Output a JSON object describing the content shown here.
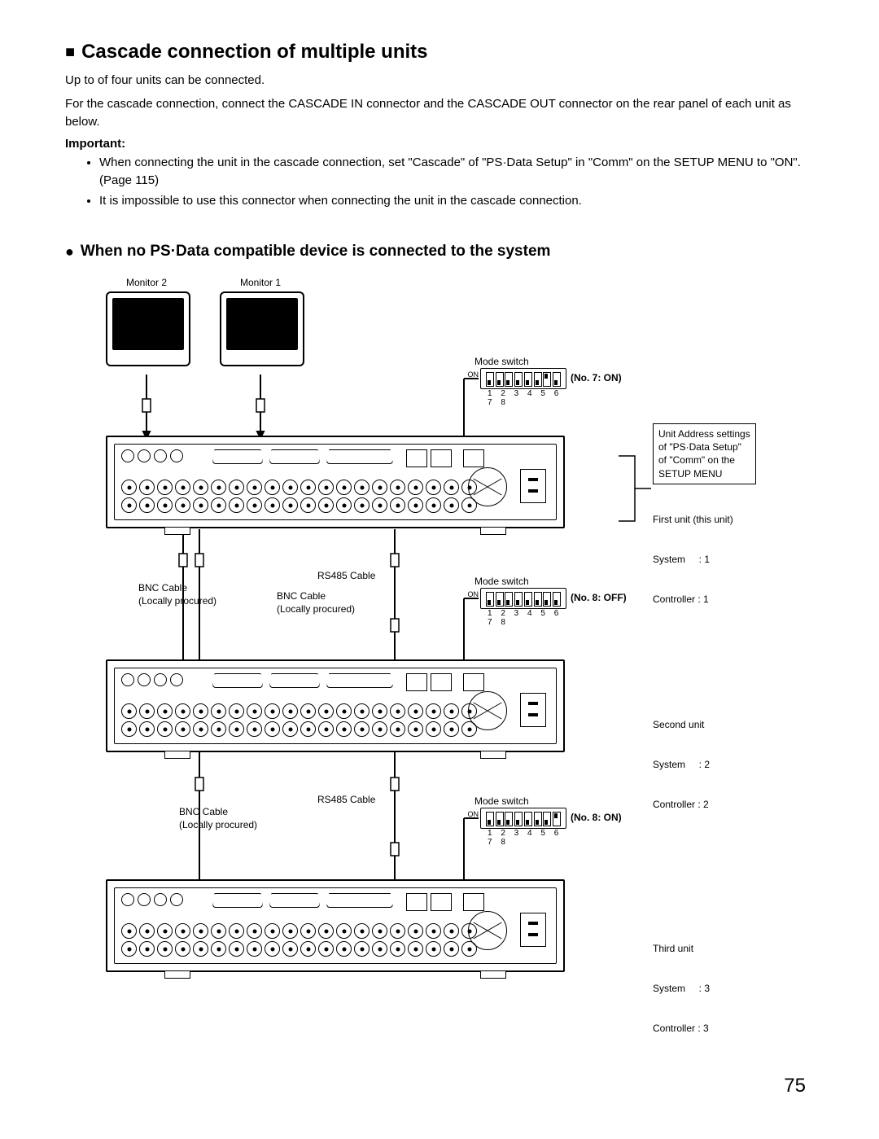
{
  "title_prefix": "■",
  "title": "Cascade connection of multiple units",
  "intro1": "Up to of four units can be connected.",
  "intro2": "For the cascade connection, connect the CASCADE IN connector and the CASCADE OUT connector on the rear panel of each unit as below.",
  "important_label": "Important:",
  "note1": "When connecting the unit in the cascade connection, set \"Cascade\" of \"PS·Data Setup\" in \"Comm\" on the SETUP MENU to \"ON\". (Page 115)",
  "note2": "It is impossible to use this connector when connecting the unit in the cascade connection.",
  "section_prefix": "●",
  "section_title": "When no PS·Data compatible device is connected to the system",
  "monitor2": "Monitor 2",
  "monitor1": "Monitor 1",
  "mode_switch_label": "Mode switch",
  "dip_numbers": "1 2 3 4 5 6 7 8",
  "dip_on": "ON",
  "dip1_note": "(No. 7: ON)",
  "dip2_note": "(No. 8: OFF)",
  "dip3_note": "(No. 8: ON)",
  "address_box_l1": "Unit Address settings",
  "address_box_l2": "of \"PS·Data Setup\"",
  "address_box_l3": "of \"Comm\" on the",
  "address_box_l4": "SETUP MENU",
  "unit1_l1": "First unit (this unit)",
  "unit1_l2": "System     : 1",
  "unit1_l3": "Controller : 1",
  "unit2_l1": "Second unit",
  "unit2_l2": "System     : 2",
  "unit2_l3": "Controller : 2",
  "unit3_l1": "Third unit",
  "unit3_l2": "System     : 3",
  "unit3_l3": "Controller : 3",
  "bnc_cable_l1": "BNC Cable",
  "bnc_cable_l2": "(Locally procured)",
  "rs485_cable": "RS485 Cable",
  "page_number": "75",
  "chart_data": {
    "type": "diagram",
    "units": [
      {
        "name": "First unit (this unit)",
        "system": 1,
        "controller": 1,
        "mode_switch": {
          "no": 7,
          "state": "ON"
        }
      },
      {
        "name": "Second unit",
        "system": 2,
        "controller": 2,
        "mode_switch": {
          "no": 8,
          "state": "OFF"
        }
      },
      {
        "name": "Third unit",
        "system": 3,
        "controller": 3,
        "mode_switch": {
          "no": 8,
          "state": "ON"
        }
      }
    ],
    "monitors": [
      "Monitor 1",
      "Monitor 2"
    ],
    "cables": [
      "BNC Cable (Locally procured)",
      "RS485 Cable"
    ],
    "settings_path": "Unit Address settings of \"PS·Data Setup\" of \"Comm\" on the SETUP MENU"
  }
}
